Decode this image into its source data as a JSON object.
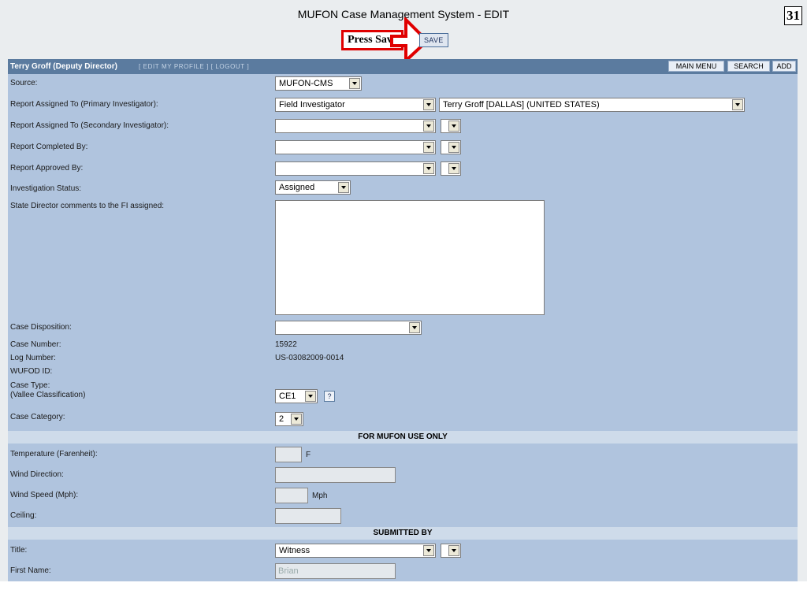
{
  "page": {
    "title": "MUFON Case Management System - EDIT",
    "page_number": "31",
    "callout": "Press Save",
    "save_label": "SAVE"
  },
  "header": {
    "user": "Terry Groff (Deputy Director)",
    "edit_profile": "[ EDIT MY PROFILE ]",
    "logout": "[ LOGOUT ]",
    "main_menu": "MAIN MENU",
    "search": "SEARCH",
    "add": "ADD"
  },
  "form": {
    "source": {
      "label": "Source:",
      "value": "MUFON-CMS"
    },
    "primary": {
      "label": "Report Assigned To (Primary Investigator):",
      "role": "Field Investigator",
      "person": "Terry Groff [DALLAS] (UNITED STATES)"
    },
    "secondary": {
      "label": "Report Assigned To (Secondary Investigator):",
      "role": ""
    },
    "completed": {
      "label": "Report Completed By:",
      "role": ""
    },
    "approved": {
      "label": "Report Approved By:",
      "role": ""
    },
    "status": {
      "label": "Investigation Status:",
      "value": "Assigned"
    },
    "comments": {
      "label": "State Director comments to the FI assigned:",
      "value": ""
    },
    "disposition": {
      "label": "Case Disposition:",
      "value": ""
    },
    "case_number": {
      "label": "Case Number:",
      "value": "15922"
    },
    "log_number": {
      "label": "Log Number:",
      "value": "US-03082009-0014"
    },
    "wufod": {
      "label": "WUFOD ID:",
      "value": ""
    },
    "case_type": {
      "label": "Case Type:",
      "sublabel": "(Vallee Classification)",
      "value": "CE1",
      "help": "?"
    },
    "case_category": {
      "label": "Case Category:",
      "value": "2"
    },
    "mufon_only": {
      "heading": "FOR MUFON USE ONLY"
    },
    "temperature": {
      "label": "Temperature (Farenheit):",
      "value": "",
      "unit": "F"
    },
    "wind_direction": {
      "label": "Wind Direction:",
      "value": ""
    },
    "wind_speed": {
      "label": "Wind Speed (Mph):",
      "value": "",
      "unit": "Mph"
    },
    "ceiling": {
      "label": "Ceiling:",
      "value": ""
    },
    "submitted_by": {
      "heading": "SUBMITTED BY"
    },
    "title": {
      "label": "Title:",
      "value": "Witness"
    },
    "first_name": {
      "label": "First Name:",
      "value": "Brian"
    }
  }
}
